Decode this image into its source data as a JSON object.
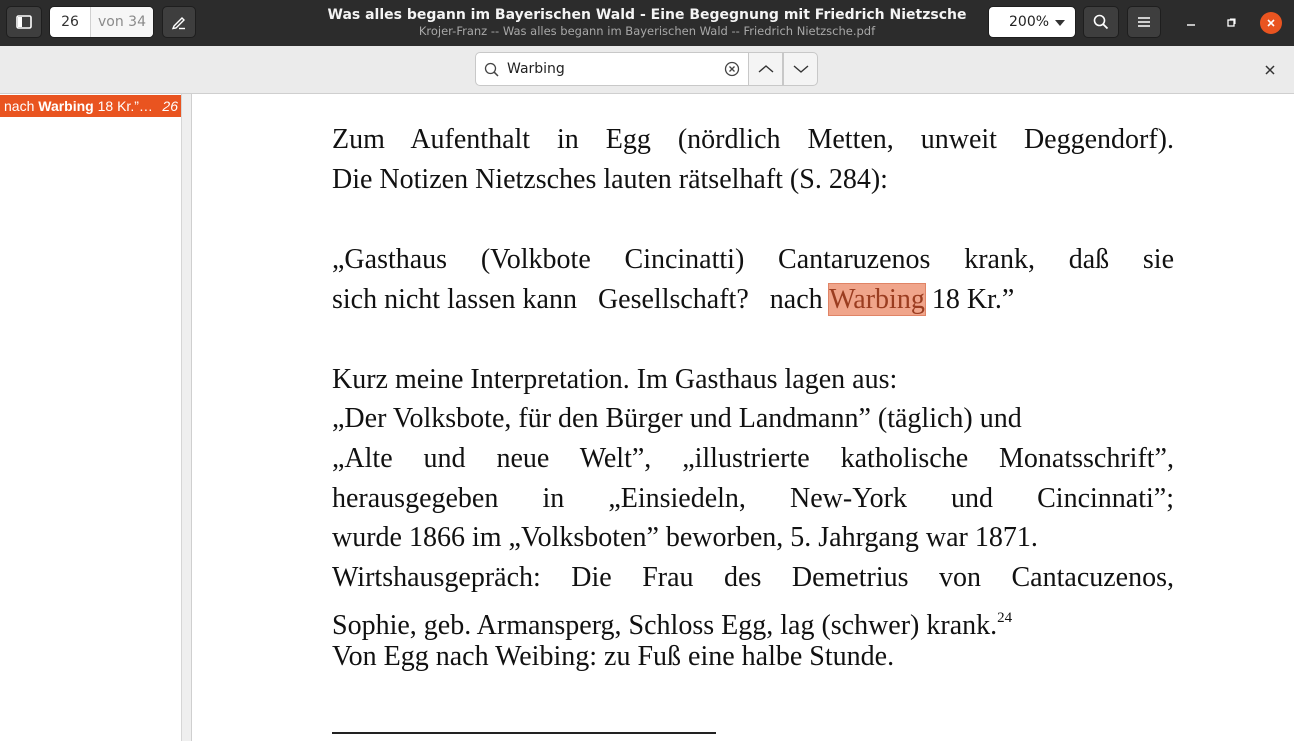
{
  "header": {
    "title": "Was alles begann im Bayerischen Wald - Eine Begegnung mit Friedrich Nietzsche",
    "subtitle": "Krojer-Franz -- Was alles begann im Bayerischen Wald -- Friedrich Nietzsche.pdf",
    "page_current": "26",
    "page_total": "von 34",
    "zoom": "200%",
    "icons": [
      "sidebar-toggle-icon",
      "annotate-pencil-icon",
      "search-icon",
      "hamburger-menu-icon",
      "minimize-icon",
      "maximize-icon",
      "close-icon"
    ],
    "close_color": "#e95420"
  },
  "findbar": {
    "query": "Warbing",
    "icons": [
      "search-icon",
      "clear-icon",
      "chevron-up-icon",
      "chevron-down-icon",
      "close-icon"
    ]
  },
  "sidebar": {
    "results": [
      {
        "prefix": "nach ",
        "match": "Warbing",
        "suffix": " 18 Kr.”…",
        "page": "26"
      }
    ],
    "highlight_color": "#e95420"
  },
  "document": {
    "para1": [
      "Zum Aufenthalt in Egg (nördlich Metten, unweit Deggendorf).",
      "Die Notizen Nietzsches lauten rätselhaft (S. 284):"
    ],
    "quote_line1": "„Gasthaus (Volkbote Cincinatti)    Cantaruzenos krank, daß sie",
    "quote_line2_before": "sich nicht lassen kann   Gesellschaft?   nach ",
    "quote_match": "Warbing",
    "quote_line2_after": " 18 Kr.”",
    "para3": [
      "Kurz meine Interpretation. Im Gasthaus lagen aus:",
      "„Der Volksbote, für den Bürger und Landmann” (täglich) und",
      "„Alte und neue Welt”, „illustrierte katholische Monatsschrift”,",
      "herausgegeben in „Einsiedeln, New-York und Cincinnati”;",
      "wurde 1866 im „Volksboten” beworben, 5. Jahrgang war 1871.",
      "Wirtshausgepräch: Die Frau des Demetrius von Cantacuzenos,",
      "Sophie, geb. Armansperg, Schloss Egg, lag (schwer) krank."
    ],
    "footnote_mark": "24",
    "last_line": "Von Egg nach Weibing: zu Fuß eine halbe Stunde.",
    "match_highlight_color": "#f0a58b"
  }
}
